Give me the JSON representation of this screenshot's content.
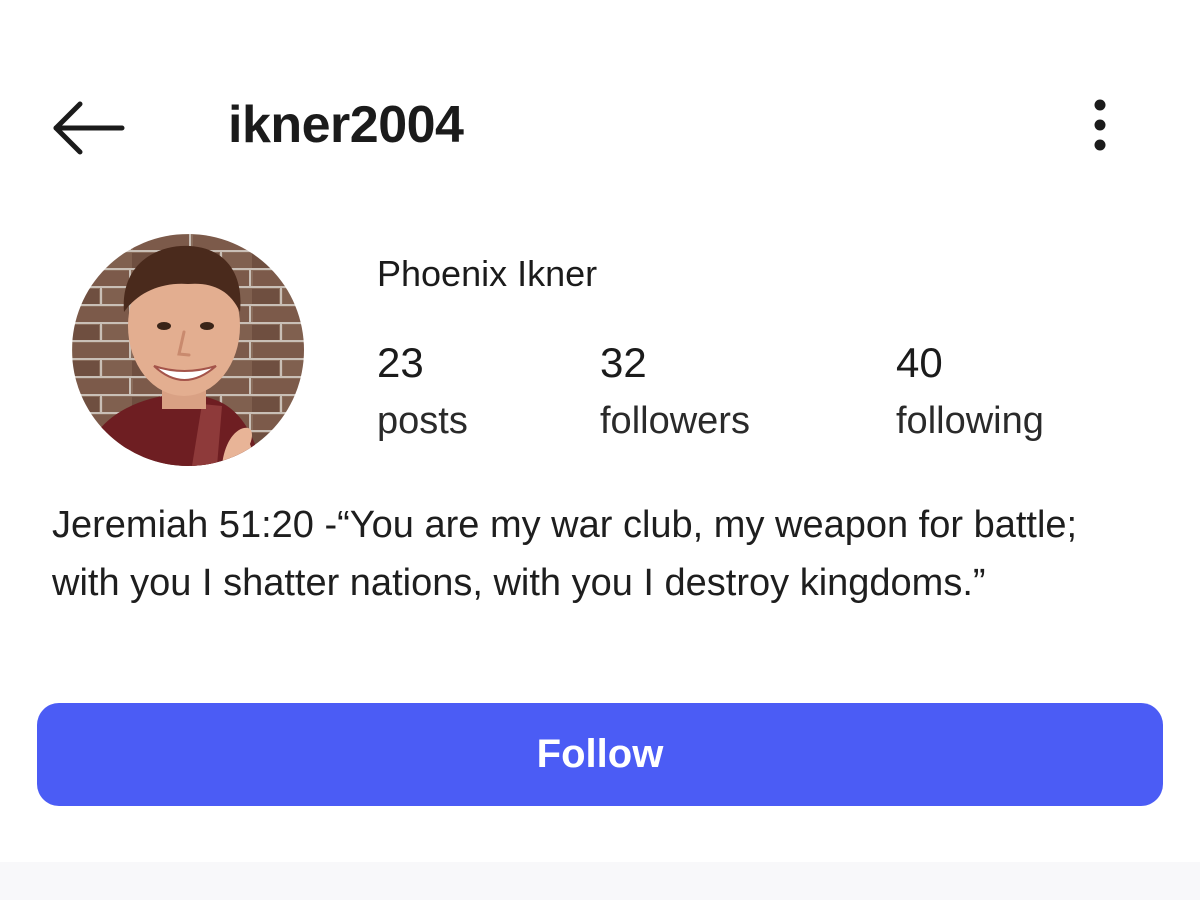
{
  "header": {
    "username": "ikner2004",
    "back_icon": "arrow-left-icon",
    "more_icon": "vertical-dots-icon"
  },
  "profile": {
    "display_name": "Phoenix Ikner",
    "avatar": "profile-photo",
    "stats": {
      "posts": {
        "count": "23",
        "label": "posts"
      },
      "followers": {
        "count": "32",
        "label": "followers"
      },
      "following": {
        "count": "40",
        "label": "following"
      }
    },
    "bio": "Jeremiah 51:20 -“You are my war club, my weapon for battle; with you I shatter nations, with you I destroy kingdoms.”"
  },
  "actions": {
    "follow_label": "Follow"
  },
  "colors": {
    "accent": "#4b5cf5",
    "text": "#1b1b1b",
    "background": "#ffffff"
  }
}
